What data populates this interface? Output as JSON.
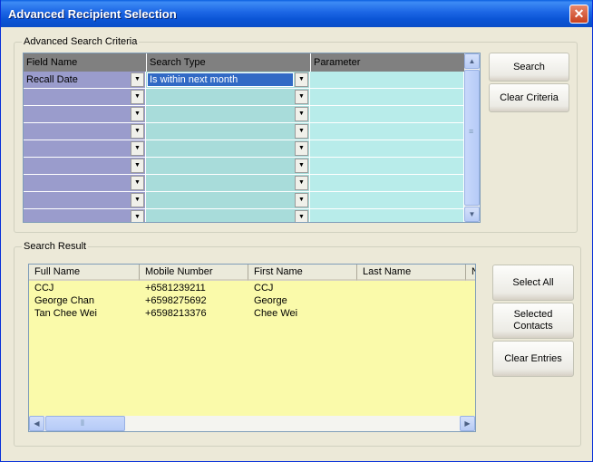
{
  "window": {
    "title": "Advanced Recipient Selection"
  },
  "criteria": {
    "legend": "Advanced Search Criteria",
    "columns": [
      "Field Name",
      "Search Type",
      "Parameter"
    ],
    "rows": [
      {
        "field": "Recall Date",
        "type": "Is within next month",
        "param": ""
      },
      {
        "field": "",
        "type": "",
        "param": ""
      },
      {
        "field": "",
        "type": "",
        "param": ""
      },
      {
        "field": "",
        "type": "",
        "param": ""
      },
      {
        "field": "",
        "type": "",
        "param": ""
      },
      {
        "field": "",
        "type": "",
        "param": ""
      },
      {
        "field": "",
        "type": "",
        "param": ""
      },
      {
        "field": "",
        "type": "",
        "param": ""
      },
      {
        "field": "",
        "type": "",
        "param": ""
      }
    ],
    "buttons": {
      "search": "Search",
      "clear": "Clear Criteria"
    }
  },
  "results": {
    "legend": "Search Result",
    "columns": [
      "Full Name",
      "Mobile Number",
      "First Name",
      "Last Name",
      "N"
    ],
    "rows": [
      {
        "full_name": "CCJ",
        "mobile": "+6581239211",
        "first_name": "CCJ",
        "last_name": ""
      },
      {
        "full_name": "George Chan",
        "mobile": "+6598275692",
        "first_name": "George",
        "last_name": ""
      },
      {
        "full_name": "Tan Chee Wei",
        "mobile": "+6598213376",
        "first_name": "Chee Wei",
        "last_name": ""
      }
    ],
    "buttons": {
      "select_all": "Select All",
      "selected_contacts": "Selected Contacts",
      "clear_entries": "Clear Entries"
    }
  },
  "colors": {
    "titlebar": "#0a5fe0",
    "field_cells": "#9a9ccc",
    "type_cells": "#a8dcda",
    "param_cells": "#b8ecea",
    "list_bg": "#fafaaa",
    "selection": "#316ac5"
  }
}
